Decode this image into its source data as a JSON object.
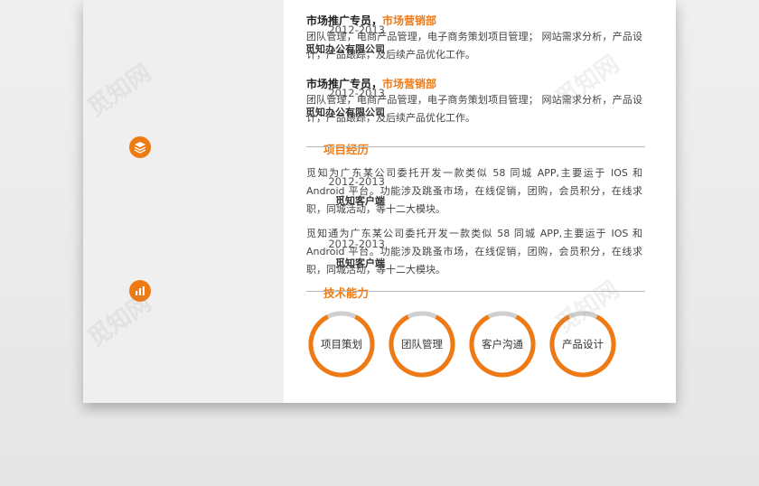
{
  "experience": [
    {
      "date": "2012-2013",
      "company": "觅知办公有限公司",
      "title": "市场推广专员，",
      "dept": "市场营销部",
      "desc": "团队管理，电商产品管理，电子商务策划项目管理；  网站需求分析，产品设计，产品跟踪，及后续产品优化工作。"
    },
    {
      "date": "2012-2013",
      "company": "觅知办公有限公司",
      "title": "市场推广专员，",
      "dept": "市场营销部",
      "desc": "团队管理，电商产品管理，电子商务策划项目管理；  网站需求分析，产品设计，产品跟踪，及后续产品优化工作。"
    }
  ],
  "projects_section": {
    "title": "项目经历",
    "icon": "layers-icon"
  },
  "projects": [
    {
      "date": "2012-2013",
      "client": "觅知客户端",
      "desc": "觅知为广东某公司委托开发一款类似 58 同城 APP,主要运于 IOS 和 Android 平台。功能涉及跳蚤市场，在线促销，团购，会员积分，在线求职，同城活动，等十二大模块。"
    },
    {
      "date": "2012-2013",
      "client": "觅知客户端",
      "desc": "觅知通为广东某公司委托开发一款类似 58 同城 APP,主要运于 IOS 和 Android 平台。功能涉及跳蚤市场，在线促销，团购，会员积分，在线求职，同城活动，等十二大模块。"
    }
  ],
  "skills_section": {
    "title": "技术能力",
    "icon": "bar-chart-icon"
  },
  "skills": [
    {
      "label": "项目策划",
      "level": 0.85
    },
    {
      "label": "团队管理",
      "level": 0.85
    },
    {
      "label": "客户沟通",
      "level": 0.85
    },
    {
      "label": "产品设计",
      "level": 0.85
    }
  ],
  "watermark": "觅知网",
  "colors": {
    "accent": "#ef7a14",
    "ring_track": "#cfcfcf",
    "sidebar": "#efefef"
  }
}
